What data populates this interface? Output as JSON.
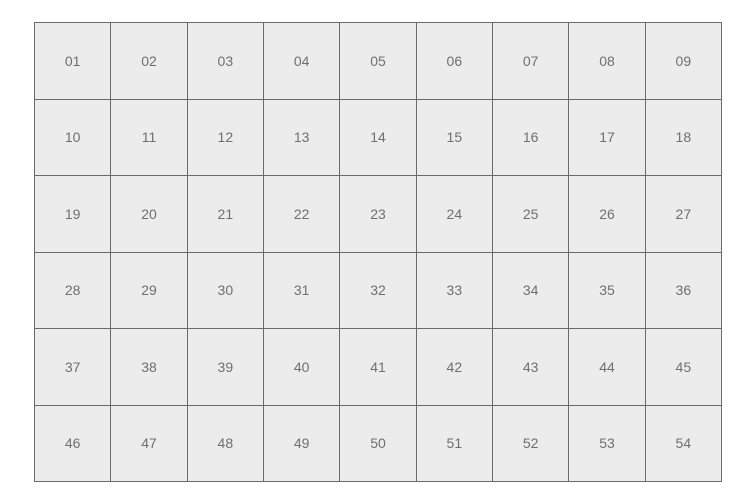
{
  "grid": {
    "cells": [
      "01",
      "02",
      "03",
      "04",
      "05",
      "06",
      "07",
      "08",
      "09",
      "10",
      "11",
      "12",
      "13",
      "14",
      "15",
      "16",
      "17",
      "18",
      "19",
      "20",
      "21",
      "22",
      "23",
      "24",
      "25",
      "26",
      "27",
      "28",
      "29",
      "30",
      "31",
      "32",
      "33",
      "34",
      "35",
      "36",
      "37",
      "38",
      "39",
      "40",
      "41",
      "42",
      "43",
      "44",
      "45",
      "46",
      "47",
      "48",
      "49",
      "50",
      "51",
      "52",
      "53",
      "54"
    ]
  }
}
